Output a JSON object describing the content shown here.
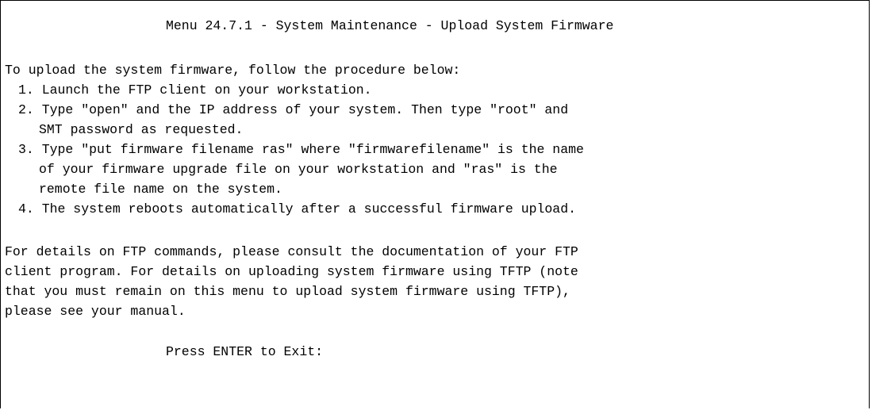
{
  "screen": {
    "title": "Menu 24.7.1 - System Maintenance - Upload System Firmware",
    "intro": "To upload the system firmware, follow the procedure below:",
    "steps": [
      "1. Launch the FTP client on your workstation.",
      "2. Type \"open\" and the IP address of your system. Then type \"root\" and",
      "SMT password as requested.",
      "3. Type \"put firmware filename ras\" where \"firmwarefilename\" is the name",
      "of your firmware upgrade file on your workstation and \"ras\" is the",
      "remote file name on the system.",
      "4. The system reboots automatically after a successful firmware upload."
    ],
    "details": [
      "For details on FTP commands, please consult the documentation of your FTP",
      "client program. For details on uploading system firmware using TFTP (note",
      "that you must remain on this menu to upload system firmware using TFTP),",
      "please see your manual."
    ],
    "prompt": "Press ENTER to Exit:"
  }
}
